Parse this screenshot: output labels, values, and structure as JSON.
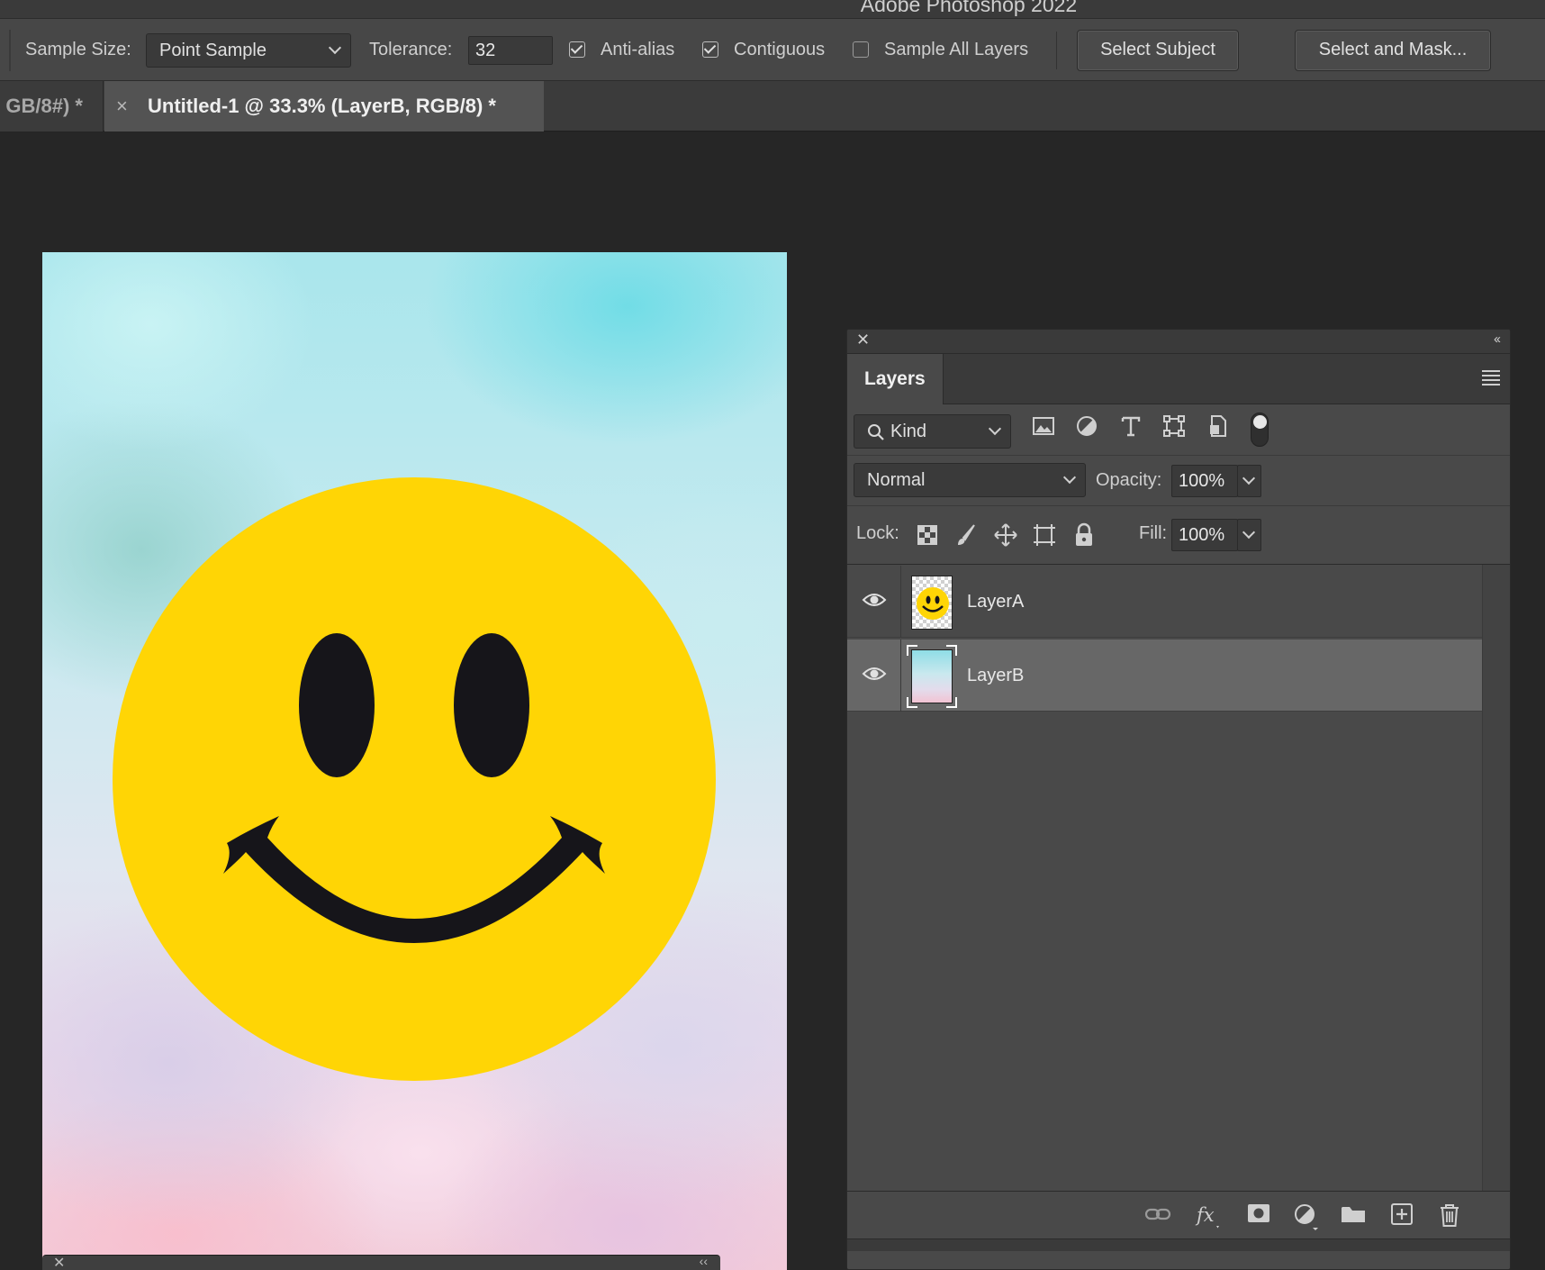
{
  "app": {
    "title": "Adobe Photoshop 2022"
  },
  "options_bar": {
    "sample_size_label": "Sample Size:",
    "sample_size_value": "Point Sample",
    "tolerance_label": "Tolerance:",
    "tolerance_value": "32",
    "anti_alias_label": "Anti-alias",
    "anti_alias_checked": true,
    "contiguous_label": "Contiguous",
    "contiguous_checked": true,
    "sample_all_layers_label": "Sample All Layers",
    "sample_all_layers_checked": false,
    "select_subject_label": "Select Subject",
    "select_and_mask_label": "Select and Mask..."
  },
  "tabs": {
    "inactive_label": "GB/8#) *",
    "active_close": "×",
    "active_label": "Untitled-1 @ 33.3% (LayerB, RGB/8) *"
  },
  "canvas": {
    "colors": {
      "face": "#ffd505",
      "features": "#16151a"
    }
  },
  "layers_panel": {
    "title": "Layers",
    "filter_kind": "Kind",
    "blend_mode": "Normal",
    "opacity_label": "Opacity:",
    "opacity_value": "100%",
    "lock_label": "Lock:",
    "fill_label": "Fill:",
    "fill_value": "100%",
    "layers": [
      {
        "name": "LayerA",
        "visible": true,
        "selected": false,
        "thumbnail": "smiley-icon"
      },
      {
        "name": "LayerB",
        "visible": true,
        "selected": true,
        "thumbnail": "watercolor-sky"
      }
    ],
    "footer_icons": [
      "link-icon",
      "fx-icon",
      "mask-icon",
      "adjustment-icon",
      "folder-icon",
      "new-layer-icon",
      "trash-icon"
    ]
  },
  "theme": {
    "accent_selected_row": "#676767",
    "panel_bg": "#494949",
    "workspace_bg": "#262626"
  }
}
